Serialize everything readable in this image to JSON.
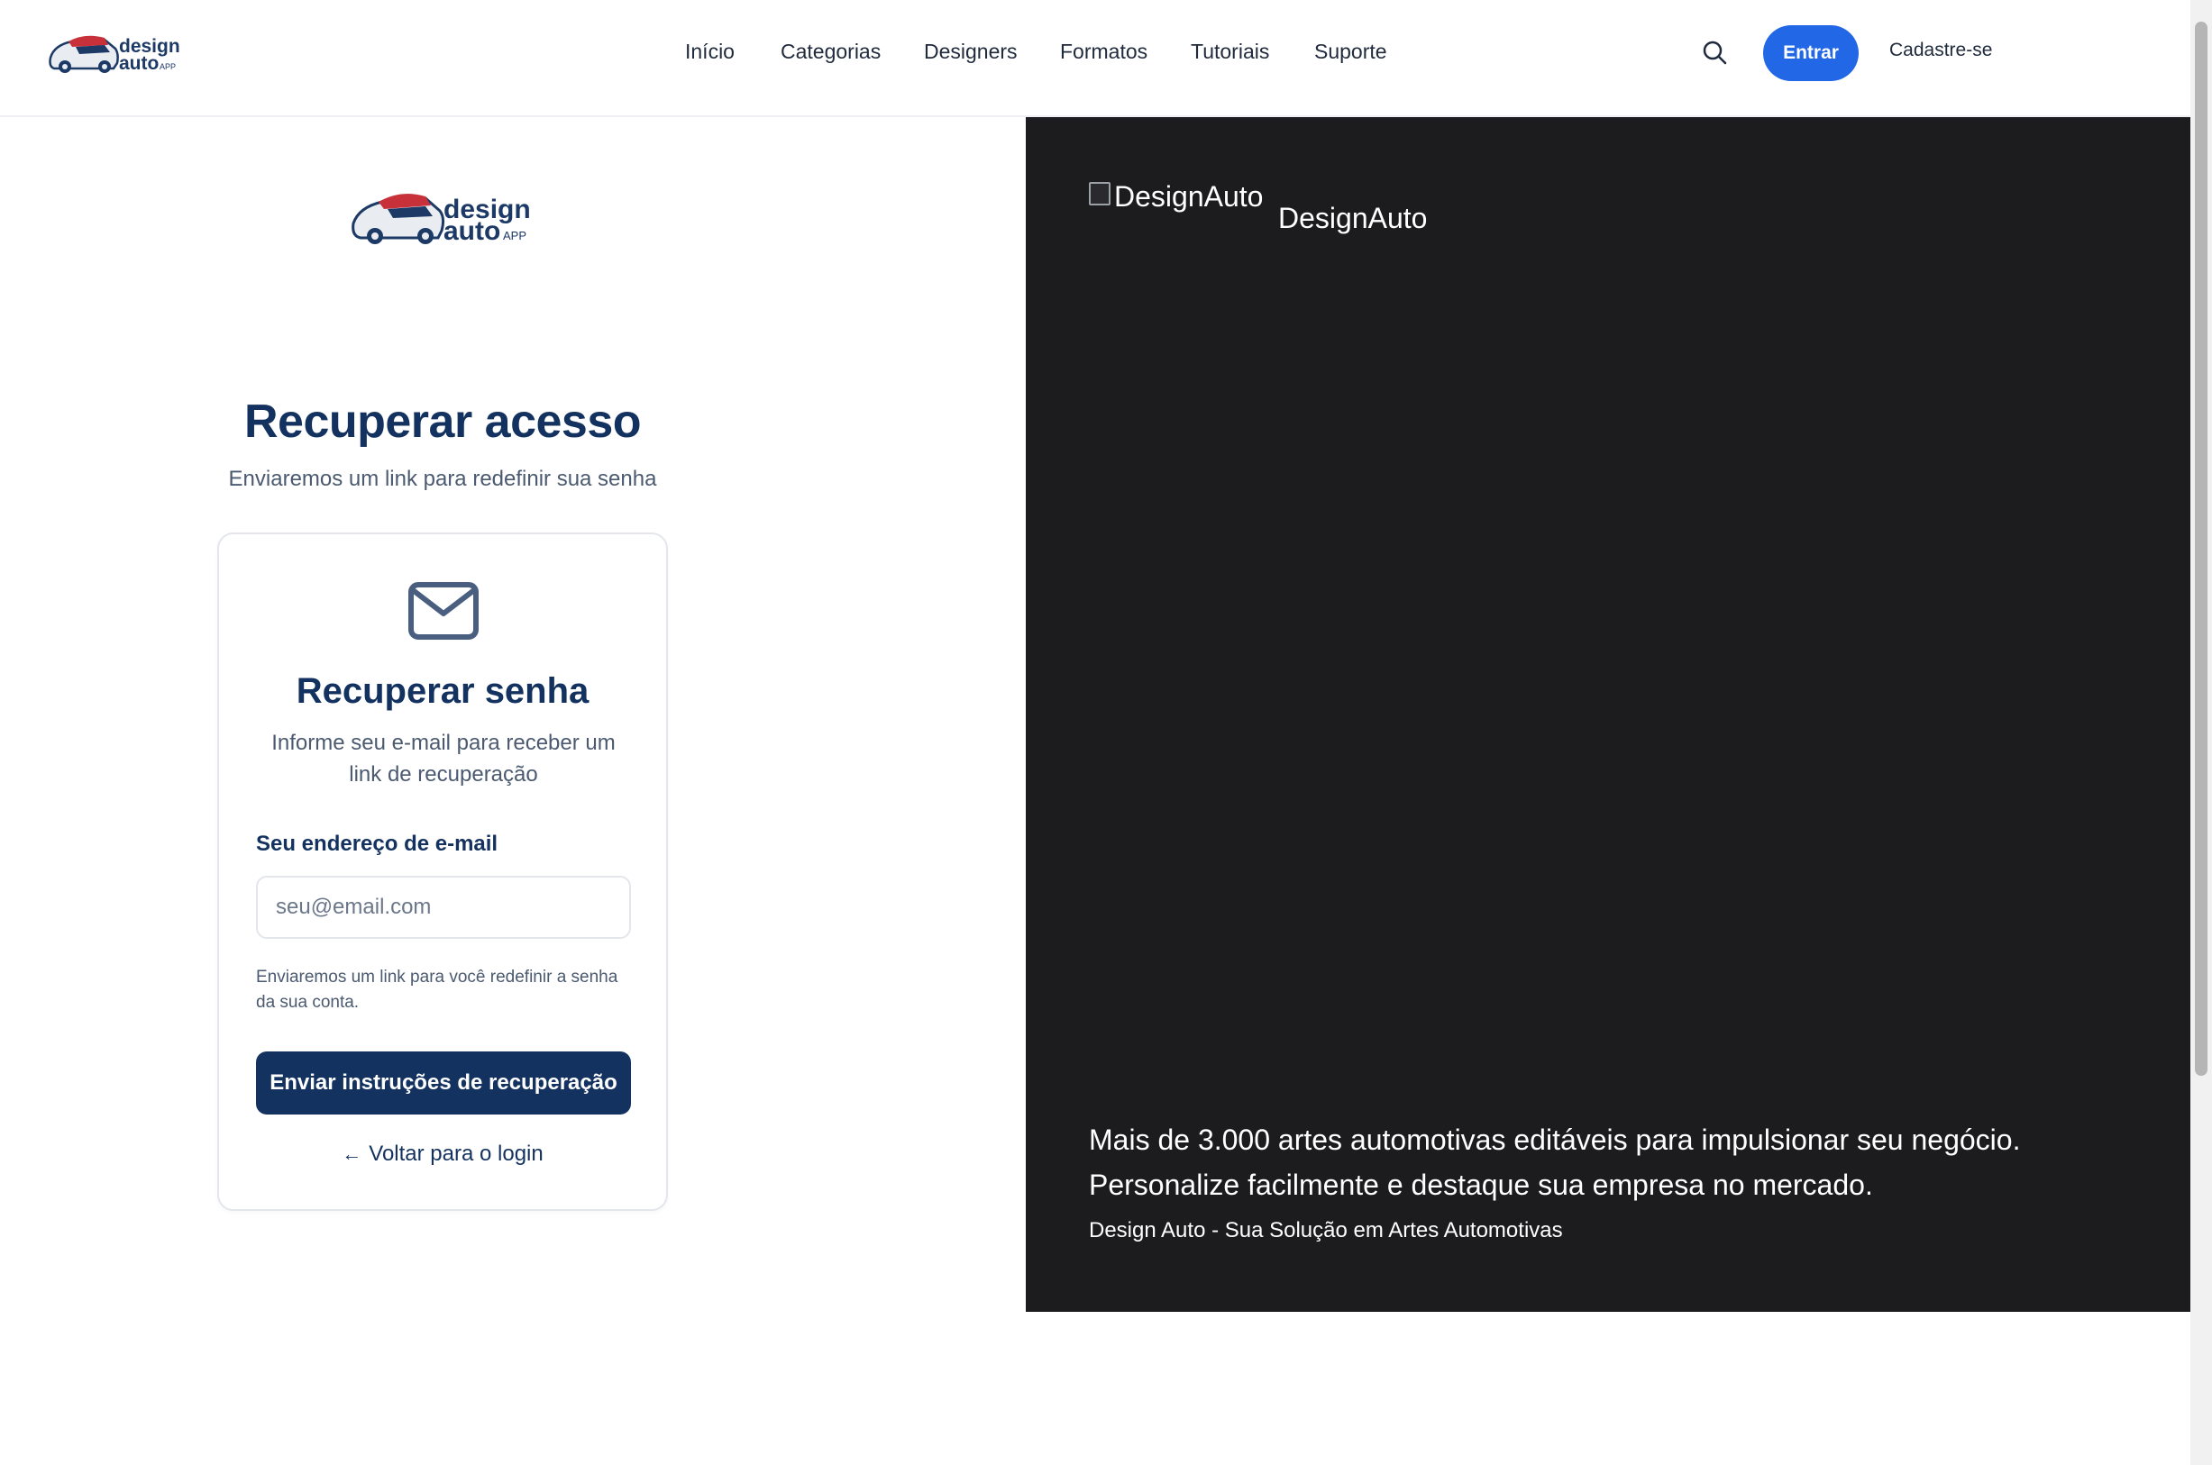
{
  "header": {
    "logo_alt": "design auto APP",
    "nav": [
      {
        "label": "Início"
      },
      {
        "label": "Categorias"
      },
      {
        "label": "Designers"
      },
      {
        "label": "Formatos"
      },
      {
        "label": "Tutoriais"
      },
      {
        "label": "Suporte"
      }
    ],
    "search_icon": "search-icon",
    "login_label": "Entrar",
    "signup_label": "Cadastre-se"
  },
  "logo": {
    "word1": "design",
    "word2": "auto",
    "word3": "APP"
  },
  "page": {
    "title": "Recuperar acesso",
    "subtitle": "Enviaremos um link para redefinir sua senha"
  },
  "card": {
    "icon": "mail-icon",
    "title": "Recuperar senha",
    "description": "Informe seu e-mail para receber um link de recuperação",
    "email_label": "Seu endereço de e-mail",
    "email_placeholder": "seu@email.com",
    "email_value": "",
    "hint": "Enviaremos um link para você redefinir a senha da sua conta.",
    "submit_label": "Enviar instruções de recuperação",
    "back_label": "Voltar para o login",
    "back_icon": "arrow-left-icon"
  },
  "hero": {
    "image_alt": "DesignAuto",
    "brand_name": "DesignAuto",
    "line1": "Mais de 3.000 artes automotivas editáveis para impulsionar seu negócio.",
    "line2": "Personalize facilmente e destaque sua empresa no mercado.",
    "footer": "Design Auto - Sua Solução em Artes Automotivas"
  },
  "colors": {
    "primary_blue": "#2167e6",
    "navy": "#14325f",
    "hero_bg": "#1c1c1f",
    "logo_red": "#c8313a"
  }
}
